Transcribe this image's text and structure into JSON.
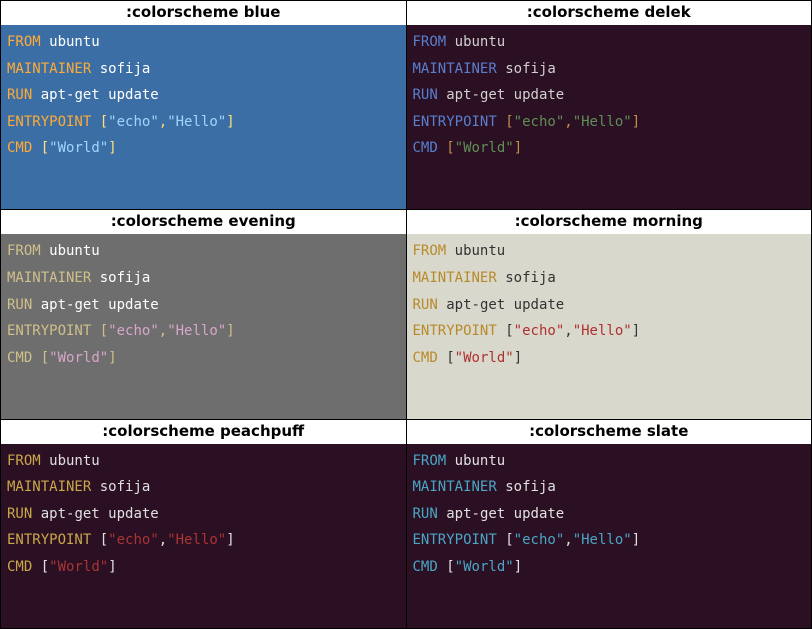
{
  "schemes": [
    {
      "key": "blue",
      "title": ":colorscheme blue"
    },
    {
      "key": "delek",
      "title": ":colorscheme delek"
    },
    {
      "key": "evening",
      "title": ":colorscheme evening"
    },
    {
      "key": "morning",
      "title": ":colorscheme morning"
    },
    {
      "key": "peachpuff",
      "title": ":colorscheme peachpuff"
    },
    {
      "key": "slate",
      "title": ":colorscheme slate"
    }
  ],
  "dockerfile": {
    "lines": [
      {
        "kw": "FROM",
        "rest": [
          {
            "t": "id",
            "v": " ubuntu"
          }
        ]
      },
      {
        "kw": "MAINTAINER",
        "rest": [
          {
            "t": "id",
            "v": " sofija"
          }
        ]
      },
      {
        "kw": "RUN",
        "rest": [
          {
            "t": "id",
            "v": " apt-get update"
          }
        ]
      },
      {
        "kw": "ENTRYPOINT",
        "rest": [
          {
            "t": "pun",
            "v": " "
          },
          {
            "t": "br",
            "v": "["
          },
          {
            "t": "str",
            "v": "\"echo\""
          },
          {
            "t": "pun",
            "v": ","
          },
          {
            "t": "str",
            "v": "\"Hello\""
          },
          {
            "t": "br",
            "v": "]"
          }
        ]
      },
      {
        "kw": "CMD",
        "rest": [
          {
            "t": "pun",
            "v": " "
          },
          {
            "t": "br",
            "v": "["
          },
          {
            "t": "str",
            "v": "\"World\""
          },
          {
            "t": "br",
            "v": "]"
          }
        ]
      }
    ]
  }
}
